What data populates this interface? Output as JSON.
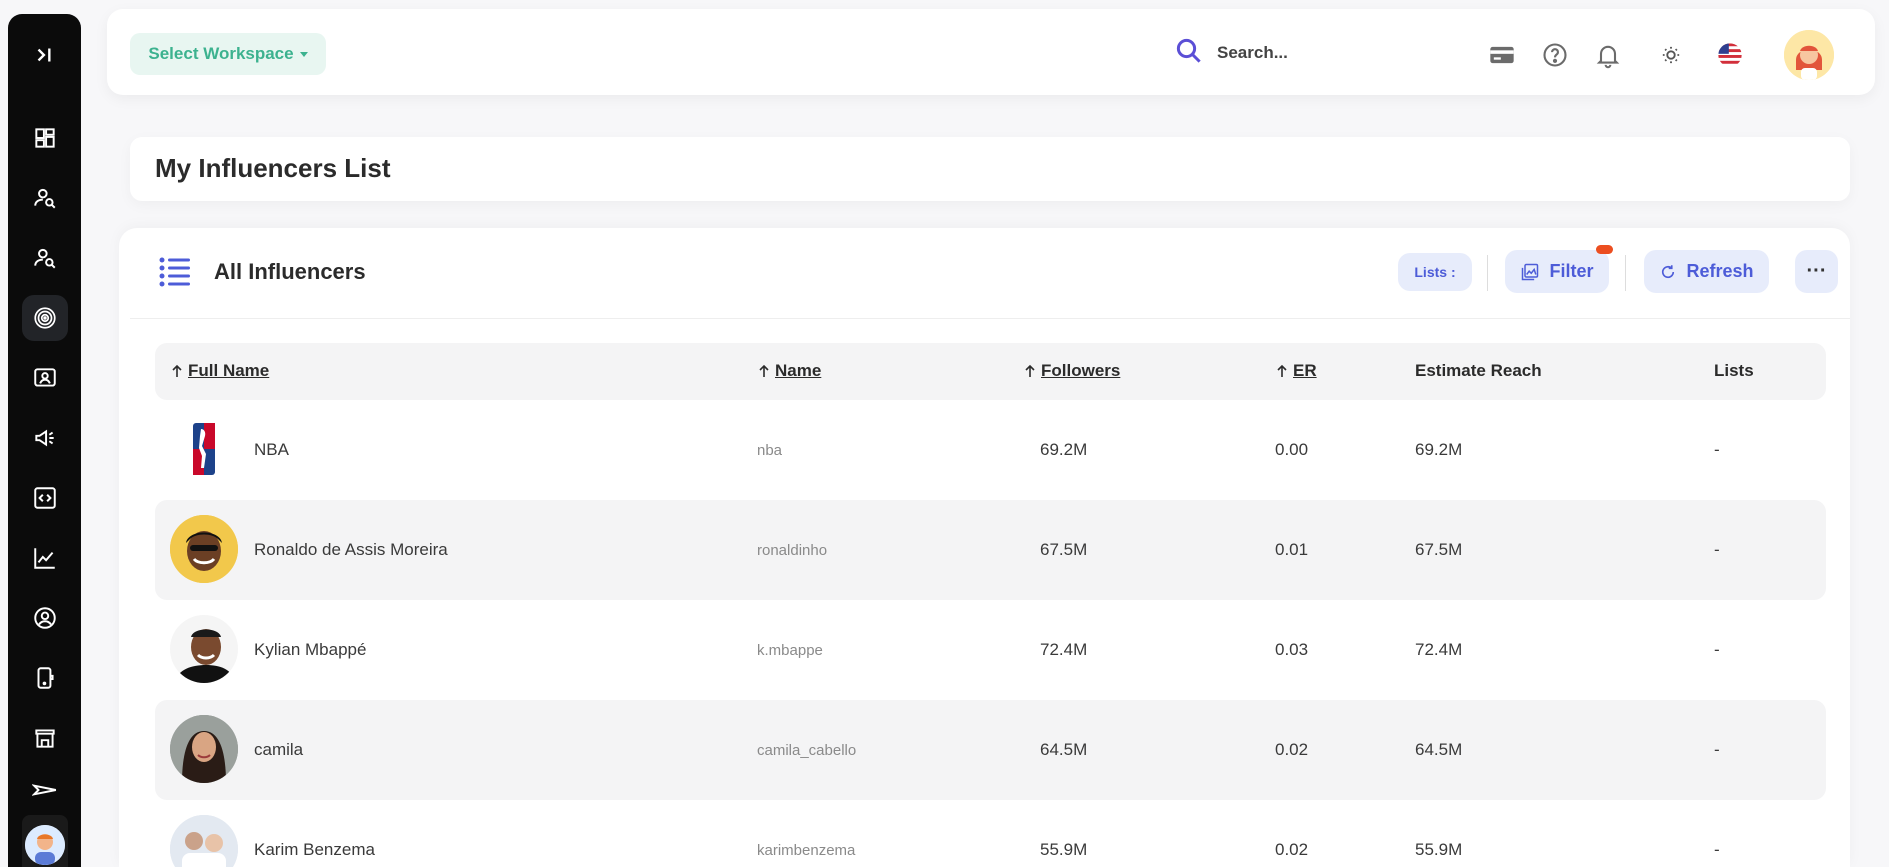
{
  "topbar": {
    "workspace_label": "Select Workspace",
    "search_placeholder": "Search...",
    "icons": [
      "card-icon",
      "help-icon",
      "bell-icon",
      "sun-icon",
      "us-flag-icon"
    ]
  },
  "sidebar": {
    "items": [
      "collapse-icon",
      "dashboard-icon",
      "search-user-icon",
      "search-user-alt-icon",
      "target-icon",
      "presentation-icon",
      "megaphone-icon",
      "code-icon",
      "chart-icon",
      "profile-icon",
      "phone-icon",
      "store-icon",
      "plane-icon"
    ]
  },
  "page": {
    "title": "My Influencers List"
  },
  "card": {
    "title": "All Influencers",
    "lists_label": "Lists :",
    "filter_label": "Filter",
    "refresh_label": "Refresh",
    "more_label": "···"
  },
  "table": {
    "columns": {
      "full_name": "Full Name",
      "name": "Name",
      "followers": "Followers",
      "er": "ER",
      "estimate_reach": "Estimate Reach",
      "lists": "Lists"
    },
    "rows": [
      {
        "full_name": "NBA",
        "name": "nba",
        "followers": "69.2M",
        "er": "0.00",
        "reach": "69.2M",
        "lists": "-"
      },
      {
        "full_name": "Ronaldo de Assis Moreira",
        "name": "ronaldinho",
        "followers": "67.5M",
        "er": "0.01",
        "reach": "67.5M",
        "lists": "-"
      },
      {
        "full_name": "Kylian Mbappé",
        "name": "k.mbappe",
        "followers": "72.4M",
        "er": "0.03",
        "reach": "72.4M",
        "lists": "-"
      },
      {
        "full_name": "camila",
        "name": "camila_cabello",
        "followers": "64.5M",
        "er": "0.02",
        "reach": "64.5M",
        "lists": "-"
      },
      {
        "full_name": "Karim Benzema",
        "name": "karimbenzema",
        "followers": "55.9M",
        "er": "0.02",
        "reach": "55.9M",
        "lists": "-"
      }
    ]
  },
  "colors": {
    "sidebar_bg": "#0b0b0b",
    "accent": "#4d5cd8",
    "workspace_green": "#3cb28f",
    "filter_badge": "#ec4e20",
    "stripe": "#f4f4f5"
  }
}
